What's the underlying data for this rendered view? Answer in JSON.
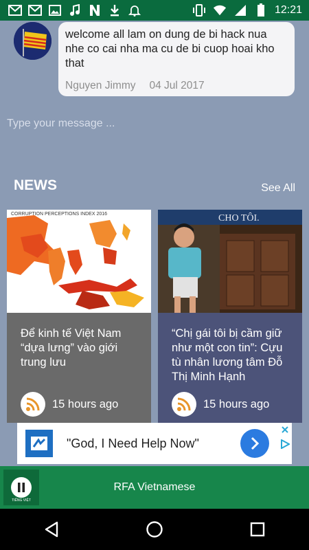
{
  "status_bar": {
    "time": "12:21",
    "left_icons": [
      "gmail-icon",
      "gmail-icon",
      "image-icon",
      "music-icon",
      "n-icon",
      "download-icon",
      "bell-icon"
    ],
    "right_icons": [
      "vibrate-icon",
      "wifi-icon",
      "signal-icon",
      "battery-icon"
    ]
  },
  "comment": {
    "text": "welcome all  lam on dung de bi hack nua nhe  co cai nha ma cu de bi cuop hoai kho that",
    "author": "Nguyen Jimmy",
    "date": "04 Jul 2017"
  },
  "message_input": {
    "placeholder": "Type your message ..."
  },
  "news": {
    "title": "NEWS",
    "see_all": "See All",
    "cards": [
      {
        "image_caption": "CORRUPTION PERCEPTIONS INDEX 2016",
        "title": "Để kinh tế Việt Nam “dựa lưng” vào giới trung lưu",
        "time": "15 hours ago"
      },
      {
        "image_caption": "CHO TÔI.",
        "title": "“Chị gái tôi bị cầm giữ như một con tin”: Cựu tù nhân lương tâm Đỗ Thị Minh Hạnh",
        "time": "15 hours ago"
      }
    ]
  },
  "ad": {
    "text": "\"God, I Need Help Now\""
  },
  "player": {
    "title": "RFA Vietnamese",
    "thumb_text": "TIẾNG VIỆT"
  },
  "colors": {
    "status_bar": "#0a6b3e",
    "background": "#8b9bb4",
    "player": "#17864b",
    "card_gray": "#6a6a6a",
    "card_blue": "#4c5379",
    "rss": "#e8952a"
  }
}
